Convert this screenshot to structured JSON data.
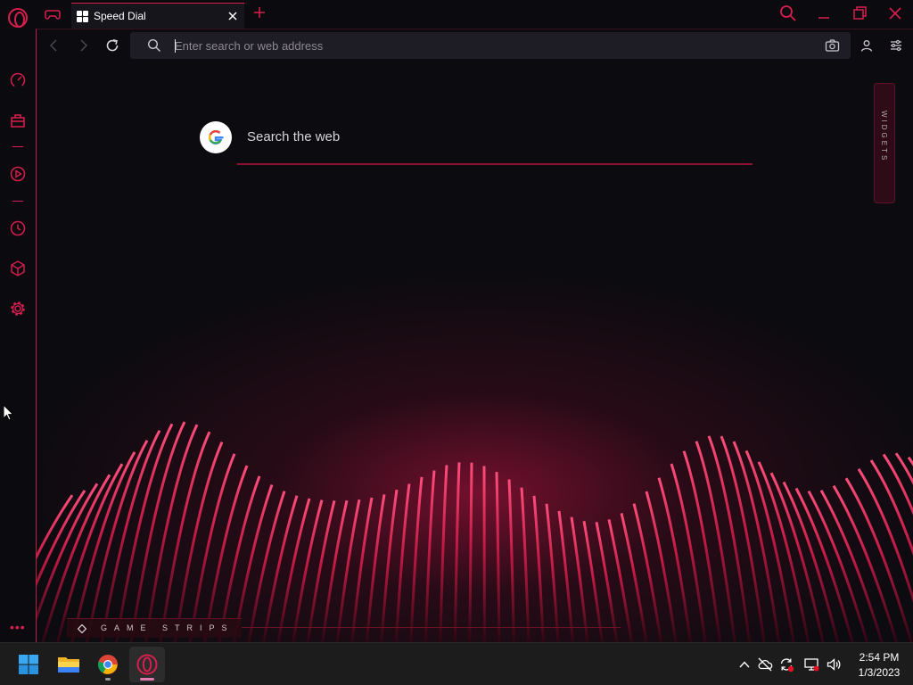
{
  "browser": {
    "tab": {
      "title": "Speed Dial"
    },
    "address_bar": {
      "placeholder": "Enter search or web address",
      "value": ""
    }
  },
  "speed_dial": {
    "search_label": "Search the web",
    "widgets_label": "WIDGETS",
    "game_strips_label": "GAME STRIPS"
  },
  "icons": {
    "titlebar": [
      "opera-gx-logo",
      "controller-icon",
      "speed-dial-grid-icon",
      "close-icon",
      "plus-icon",
      "search-icon",
      "minimize-icon",
      "maximize-icon",
      "close-icon"
    ],
    "sidebar": [
      "speedometer-icon",
      "shopping-bag-icon",
      "play-circle-icon",
      "clock-icon",
      "cube-icon",
      "gear-icon",
      "more-icon"
    ],
    "navbar": [
      "back-icon",
      "forward-icon",
      "reload-icon",
      "search-icon",
      "camera-icon",
      "profile-icon",
      "easy-setup-icon"
    ]
  },
  "taskbar": {
    "apps": [
      "Start",
      "File Explorer",
      "Google Chrome",
      "Opera GX"
    ],
    "tray": [
      "chevron-up-icon",
      "cloud-off-icon",
      "sync-icon",
      "network-icon",
      "volume-icon"
    ],
    "time": "2:54 PM",
    "date": "1/3/2023"
  },
  "theme": {
    "accent": "#d81e4f",
    "background": "#0b0a0f",
    "urlbar_bg": "#1e1c24",
    "taskbar_bg": "#1c1c1c"
  }
}
